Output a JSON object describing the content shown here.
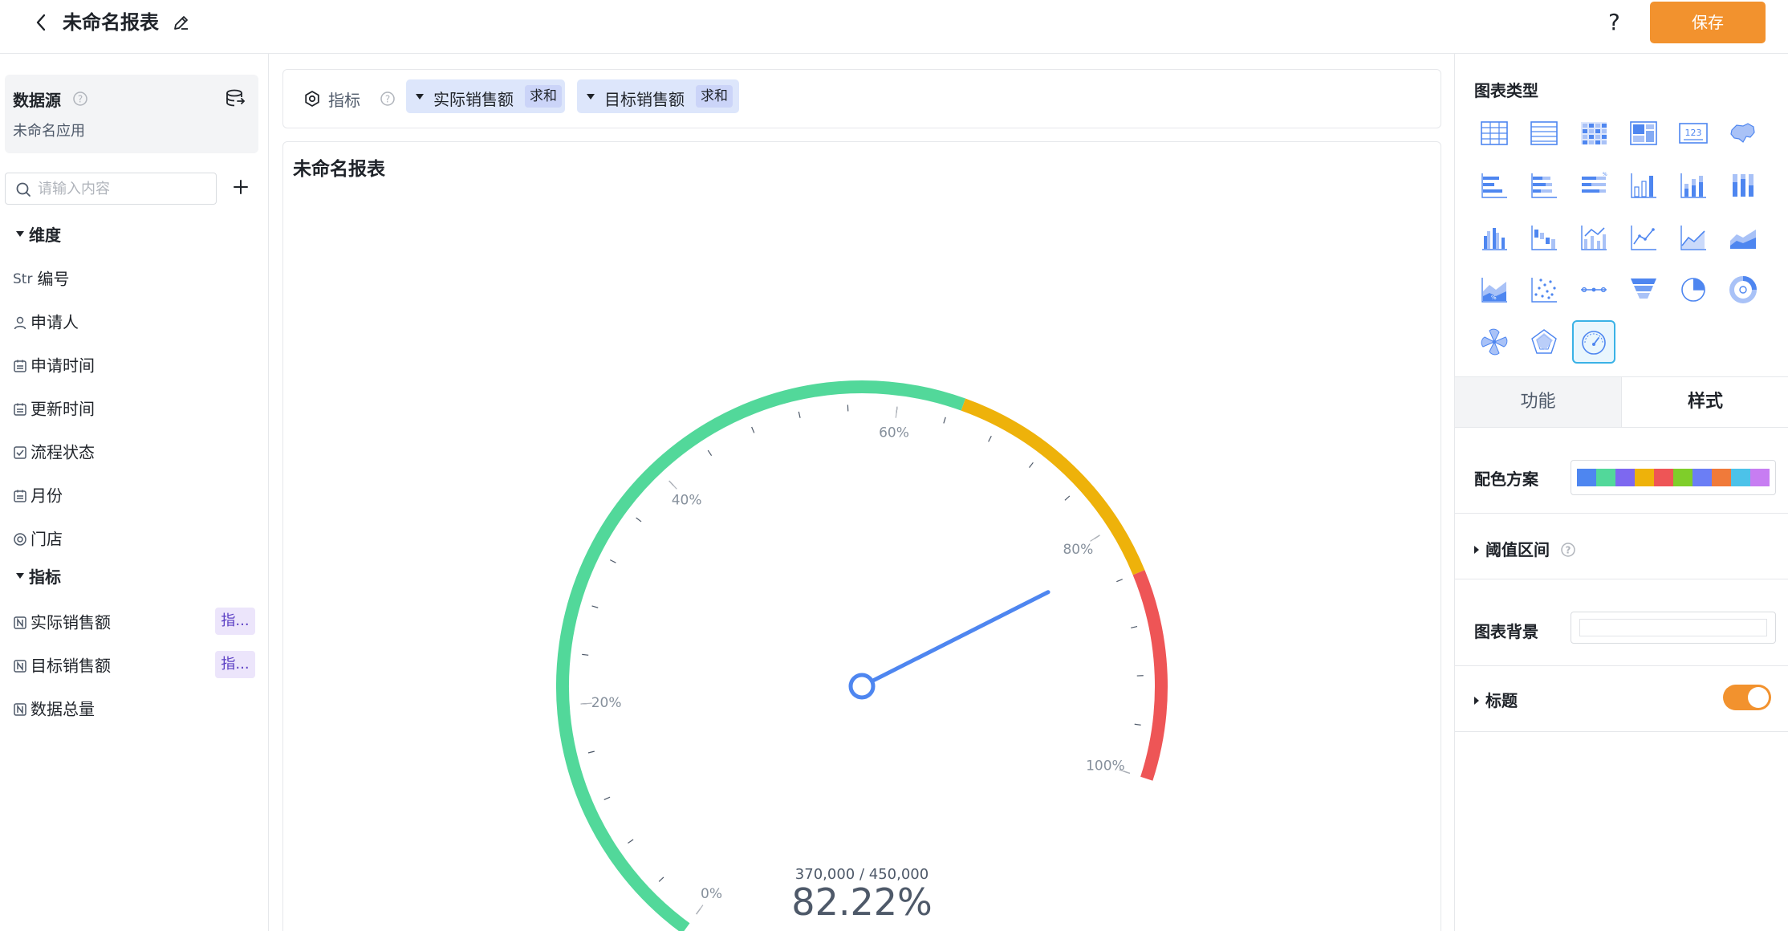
{
  "header": {
    "title": "未命名报表",
    "help_label": "?",
    "save_label": "保存"
  },
  "sidebar": {
    "datasource_label": "数据源",
    "datasource_name": "未命名应用",
    "search_placeholder": "请输入内容",
    "dimension_group": "维度",
    "dimensions": [
      {
        "label": "编号",
        "type_tag": "Str",
        "icon": "string-type-icon"
      },
      {
        "label": "申请人",
        "icon": "user-icon"
      },
      {
        "label": "申请时间",
        "icon": "calendar-icon"
      },
      {
        "label": "更新时间",
        "icon": "calendar-icon"
      },
      {
        "label": "流程状态",
        "icon": "checkbox-icon"
      },
      {
        "label": "月份",
        "icon": "calendar-icon"
      },
      {
        "label": "门店",
        "icon": "radio-icon"
      }
    ],
    "indicator_group": "指标",
    "indicators": [
      {
        "label": "实际销售额",
        "badge": "指...",
        "icon": "number-icon"
      },
      {
        "label": "目标销售额",
        "badge": "指...",
        "icon": "number-icon"
      },
      {
        "label": "数据总量",
        "icon": "number-icon"
      }
    ]
  },
  "indicator_bar": {
    "label": "指标",
    "chips": [
      {
        "label": "实际销售额",
        "agg": "求和"
      },
      {
        "label": "目标销售额",
        "agg": "求和"
      }
    ]
  },
  "chart": {
    "title": "未命名报表"
  },
  "chart_data": {
    "type": "gauge",
    "title": "未命名报表",
    "value": 370000,
    "target": 450000,
    "value_text": "370,000 / 450,000",
    "percent": 82.22,
    "percent_text": "82.22%",
    "range": [
      0,
      100
    ],
    "tick_labels": [
      "0%",
      "20%",
      "40%",
      "60%",
      "80%",
      "100%"
    ],
    "bands": [
      {
        "from": 0,
        "to": 65,
        "color": "#52d89a"
      },
      {
        "from": 65,
        "to": 84,
        "color": "#eeb20a"
      },
      {
        "from": 84,
        "to": 100,
        "color": "#ee5556"
      }
    ],
    "needle_color": "#4e86f0"
  },
  "right_panel": {
    "chart_type_label": "图表类型",
    "chart_types": [
      "table-icon",
      "list-table-icon",
      "heatmap-table-icon",
      "card-layout-icon",
      "number-card-icon",
      "map-icon",
      "bar-horizontal-icon",
      "stacked-bar-horizontal-icon",
      "percent-bar-horizontal-icon",
      "column-icon",
      "stacked-column-icon",
      "percent-column-icon",
      "grouped-column-icon",
      "waterfall-icon",
      "combo-chart-icon",
      "line-icon",
      "area-line-icon",
      "stacked-area-icon",
      "percent-area-icon",
      "scatter-icon",
      "dot-line-icon",
      "funnel-icon",
      "pie-icon",
      "donut-icon",
      "windmill-icon",
      "radar-icon",
      "gauge-icon"
    ],
    "selected_type": "gauge-icon",
    "tabs": [
      {
        "label": "功能",
        "active": false
      },
      {
        "label": "样式",
        "active": true
      }
    ],
    "color_scheme_label": "配色方案",
    "palette": [
      "#4e86f0",
      "#52d89a",
      "#7d68f0",
      "#eeb20a",
      "#ee5556",
      "#7fce2a",
      "#6b7ef5",
      "#f07a3a",
      "#4cc2e9",
      "#c77df2"
    ],
    "threshold_label": "阈值区间",
    "background_label": "图表背景",
    "title_label": "标题",
    "title_toggle_on": true
  }
}
